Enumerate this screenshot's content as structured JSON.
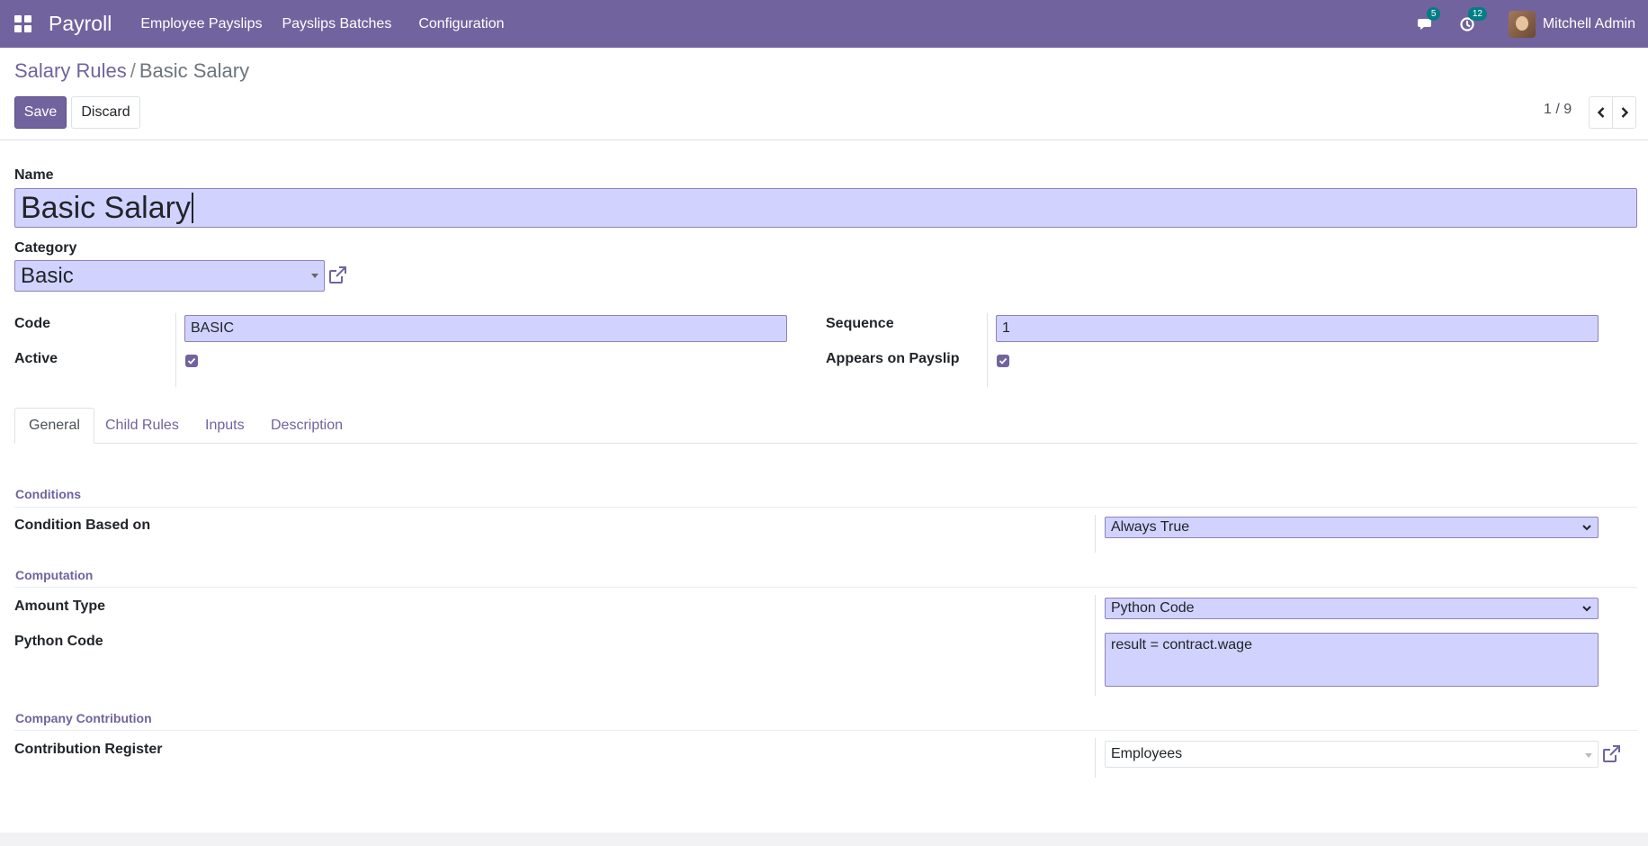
{
  "navbar": {
    "app_name": "Payroll",
    "menu": [
      "Employee Payslips",
      "Payslips Batches",
      "Configuration"
    ],
    "messages_count": "5",
    "activities_count": "12",
    "user_name": "Mitchell Admin"
  },
  "breadcrumb": {
    "parent": "Salary Rules",
    "separator": "/",
    "current": "Basic Salary"
  },
  "actions": {
    "save": "Save",
    "discard": "Discard"
  },
  "pager": {
    "value": "1 / 9"
  },
  "form": {
    "name_label": "Name",
    "name_value": "Basic Salary",
    "category_label": "Category",
    "category_value": "Basic",
    "code_label": "Code",
    "code_value": "BASIC",
    "active_label": "Active",
    "active_checked": true,
    "sequence_label": "Sequence",
    "sequence_value": "1",
    "appears_label": "Appears on Payslip",
    "appears_checked": true
  },
  "tabs": [
    "General",
    "Child Rules",
    "Inputs",
    "Description"
  ],
  "general": {
    "conditions_title": "Conditions",
    "condition_label": "Condition Based on",
    "condition_value": "Always True",
    "computation_title": "Computation",
    "amount_type_label": "Amount Type",
    "amount_type_value": "Python Code",
    "python_code_label": "Python Code",
    "python_code_value": "result = contract.wage",
    "company_contribution_title": "Company Contribution",
    "contribution_register_label": "Contribution Register",
    "contribution_register_value": "Employees"
  },
  "colors": {
    "brand": "#71639e",
    "field_bg": "#d2d2ff",
    "badge": "#017e84"
  }
}
